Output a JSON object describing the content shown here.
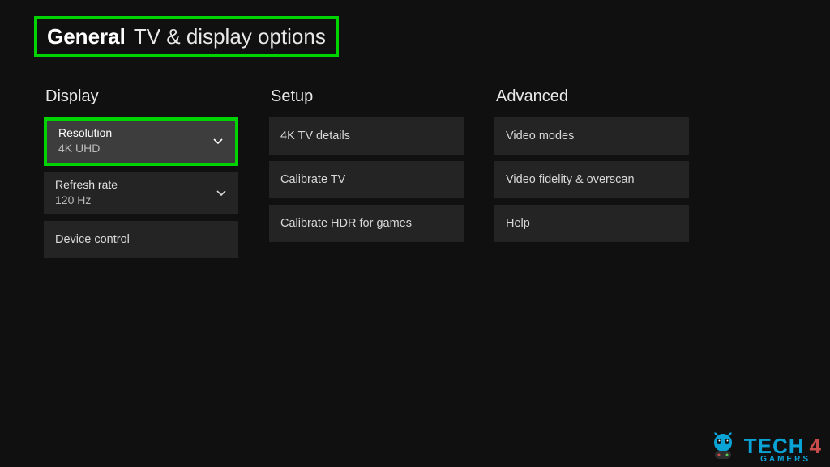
{
  "title": {
    "bold": "General",
    "rest": "TV & display options"
  },
  "columns": {
    "display": {
      "header": "Display",
      "resolution": {
        "label": "Resolution",
        "value": "4K UHD"
      },
      "refresh": {
        "label": "Refresh rate",
        "value": "120 Hz"
      },
      "device_control": "Device control"
    },
    "setup": {
      "header": "Setup",
      "four_k_details": "4K TV details",
      "calibrate_tv": "Calibrate TV",
      "calibrate_hdr": "Calibrate HDR for games"
    },
    "advanced": {
      "header": "Advanced",
      "video_modes": "Video modes",
      "video_fidelity": "Video fidelity & overscan",
      "help": "Help"
    }
  },
  "watermark": {
    "part1": "TECH",
    "part2": "4",
    "sub": "GAMERS"
  },
  "highlight_color": "#00d400"
}
